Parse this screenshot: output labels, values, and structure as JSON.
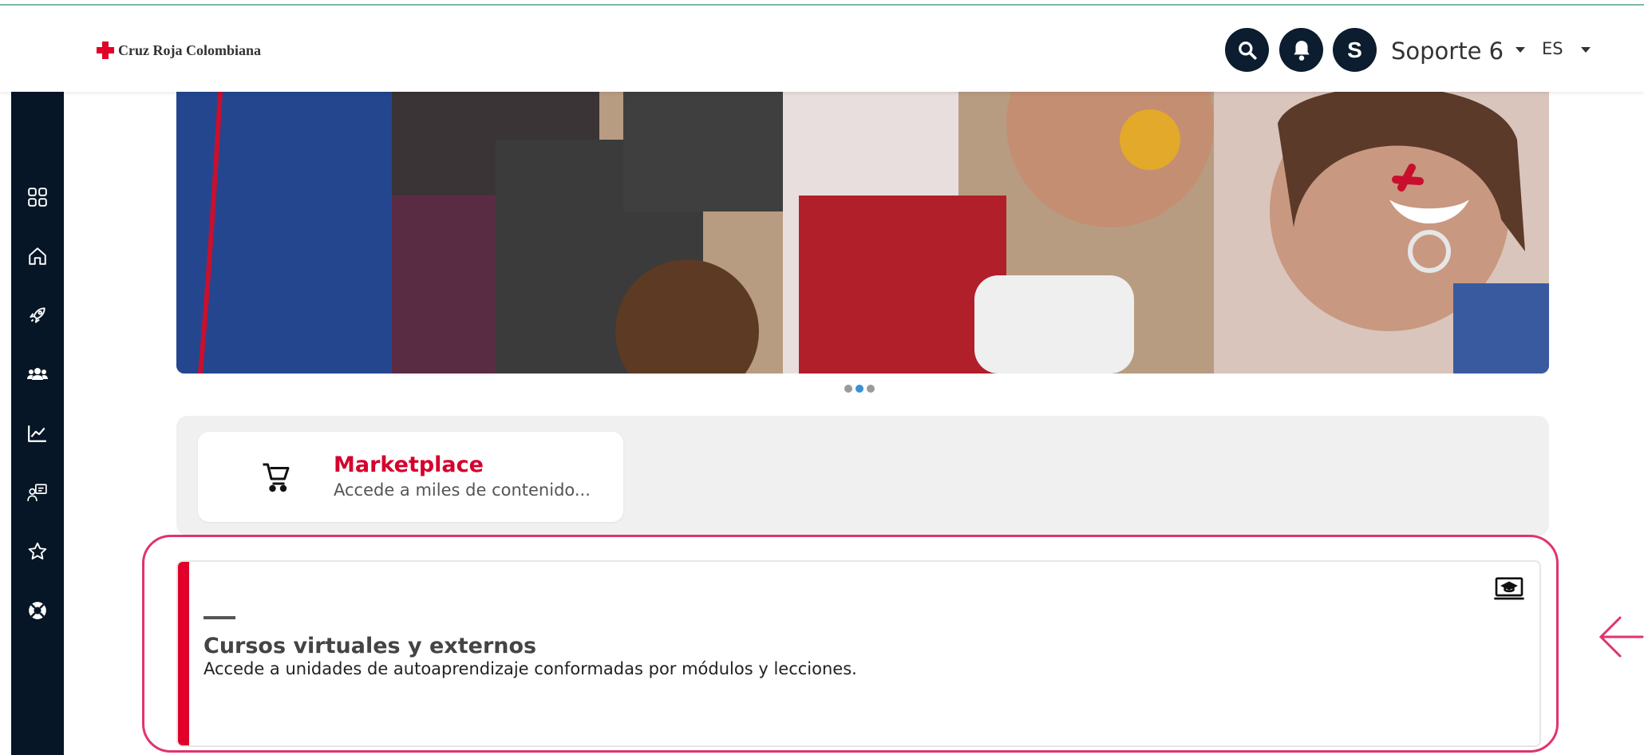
{
  "header": {
    "logo_text": "Cruz Roja Colombiana",
    "search_icon": "search-icon",
    "notifications_icon": "bell-icon",
    "avatar_letter": "S",
    "username": "Soporte 6",
    "language": "ES"
  },
  "sidebar": {
    "items": [
      {
        "icon": "grid-icon"
      },
      {
        "icon": "home-icon"
      },
      {
        "icon": "rocket-icon"
      },
      {
        "icon": "users-icon"
      },
      {
        "icon": "chart-line-icon"
      },
      {
        "icon": "teacher-icon"
      },
      {
        "icon": "star-icon"
      },
      {
        "icon": "support-icon"
      }
    ]
  },
  "carousel": {
    "dots": 3,
    "active_index": 1
  },
  "marketplace": {
    "title": "Marketplace",
    "subtitle": "Accede a miles de contenido..."
  },
  "course_card": {
    "title": "Cursos virtuales y externos",
    "description": "Accede a unidades de autoaprendizaje conformadas por módulos y lecciones."
  },
  "colors": {
    "brand_red": "#d5002c",
    "sidebar_bg": "#061626",
    "highlight": "#e0336f"
  }
}
